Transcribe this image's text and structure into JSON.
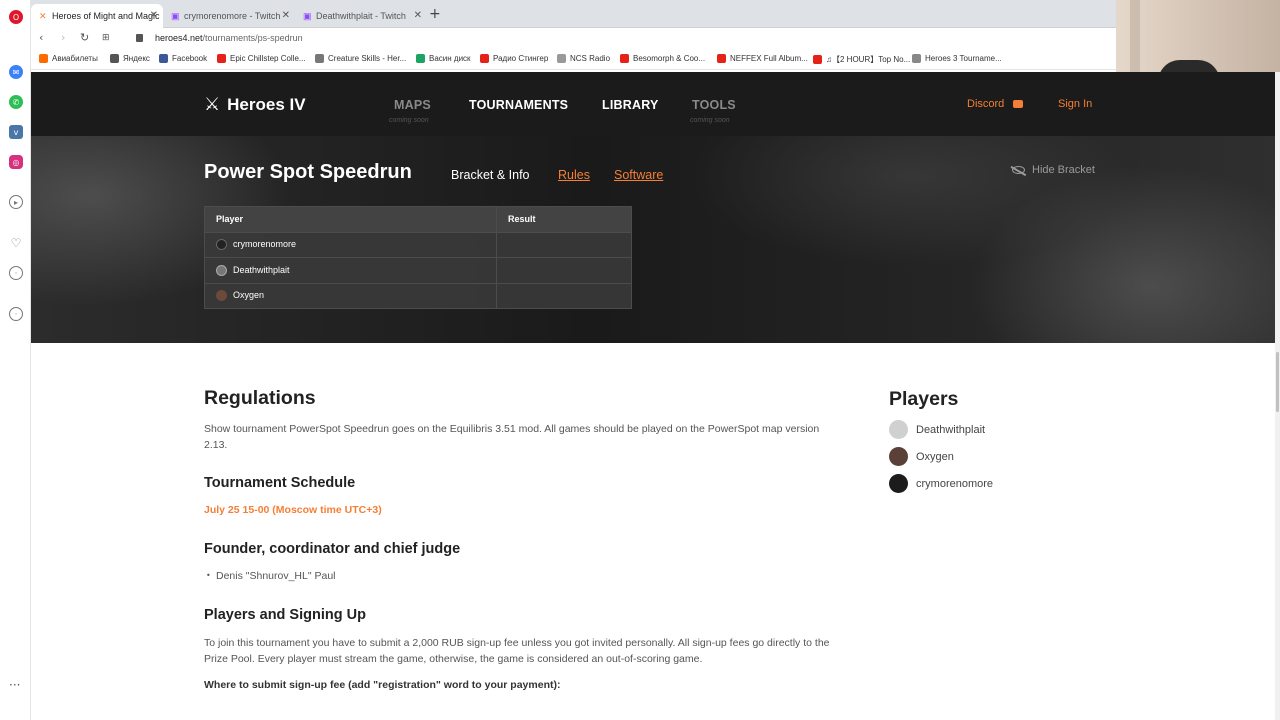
{
  "browser": {
    "tabs": [
      {
        "title": "Heroes of Might and Magic",
        "active": true
      },
      {
        "title": "crymorenomore - Twitch",
        "active": false
      },
      {
        "title": "Deathwithplait - Twitch",
        "active": false
      }
    ],
    "new_tab": "+",
    "url_domain": "heroes4.net",
    "url_path": "/tournaments/ps-spedrun",
    "bookmarks": [
      "Авиабилеты",
      "Яндекс",
      "Facebook",
      "Epic Chillstep Colle...",
      "Creature Skills - Her...",
      "Васин диск",
      "Радио Стингер",
      "NCS Radio",
      "Besomorph & Coo...",
      "NEFFEX Full Album...",
      "♫【2 HOUR】Top No...",
      "Heroes 3 Tourname..."
    ],
    "status_menu": "···"
  },
  "nav": {
    "logo": "Heroes IV",
    "maps": "MAPS",
    "maps_sub": "coming soon",
    "tournaments": "TOURNAMENTS",
    "library": "LIBRARY",
    "tools": "TOOLS",
    "tools_sub": "coming soon",
    "discord": "Discord",
    "signin": "Sign In"
  },
  "hero": {
    "title": "Power Spot Speedrun",
    "tabs": {
      "bracket": "Bracket & Info",
      "rules": "Rules",
      "software": "Software"
    },
    "hide_bracket": "Hide Bracket",
    "table": {
      "headers": [
        "Player",
        "Result"
      ],
      "rows": [
        {
          "player": "crymorenomore",
          "result": ""
        },
        {
          "player": "Deathwithplait",
          "result": ""
        },
        {
          "player": "Oxygen",
          "result": ""
        }
      ]
    }
  },
  "content": {
    "regulations_title": "Regulations",
    "regulations_text": "Show tournament PowerSpot Speedrun goes on the Equilibris 3.51 mod. All games should be played on the PowerSpot map version 2.13.",
    "schedule_title": "Tournament Schedule",
    "schedule_date": "July 25 15-00 (Moscow time UTC+3)",
    "founder_title": "Founder, coordinator and chief judge",
    "founder_name": "Denis \"Shnurov_HL\" Paul",
    "signing_title": "Players and Signing Up",
    "signing_text": "To join this tournament you have to submit a 2,000 RUB sign-up fee unless you got invited personally. All sign-up fees go directly to the Prize Pool. Every player must stream the game, otherwise, the game is considered an out-of-scoring game.",
    "where_submit": "Where to submit sign-up fee (add \"registration\" word to your payment):"
  },
  "players": {
    "title": "Players",
    "list": [
      "Deathwithplait",
      "Oxygen",
      "crymorenomore"
    ]
  },
  "colors": {
    "accent": "#f47f36",
    "nav_bg": "#1b1b1b"
  }
}
